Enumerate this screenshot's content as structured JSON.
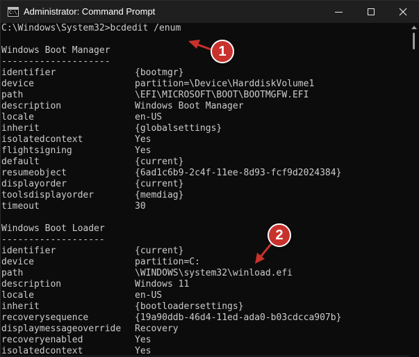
{
  "window": {
    "title": "Administrator: Command Prompt",
    "icon_name": "cmd-icon",
    "icon_text": "C:\\."
  },
  "controls": {
    "minimize_icon": "minimize-icon",
    "maximize_icon": "maximize-icon",
    "close_icon": "close-icon"
  },
  "console": {
    "prompt": "C:\\Windows\\System32>bcdedit /enum",
    "boot_manager": {
      "heading": "Windows Boot Manager",
      "separator": "--------------------",
      "entries": [
        {
          "key": "identifier",
          "value": "{bootmgr}"
        },
        {
          "key": "device",
          "value": "partition=\\Device\\HarddiskVolume1"
        },
        {
          "key": "path",
          "value": "\\EFI\\MICROSOFT\\BOOT\\BOOTMGFW.EFI"
        },
        {
          "key": "description",
          "value": "Windows Boot Manager"
        },
        {
          "key": "locale",
          "value": "en-US"
        },
        {
          "key": "inherit",
          "value": "{globalsettings}"
        },
        {
          "key": "isolatedcontext",
          "value": "Yes"
        },
        {
          "key": "flightsigning",
          "value": "Yes"
        },
        {
          "key": "default",
          "value": "{current}"
        },
        {
          "key": "resumeobject",
          "value": "{6ad1c6b9-2c4f-11ee-8d93-fcf9d2024384}"
        },
        {
          "key": "displayorder",
          "value": "{current}"
        },
        {
          "key": "toolsdisplayorder",
          "value": "{memdiag}"
        },
        {
          "key": "timeout",
          "value": "30"
        }
      ]
    },
    "boot_loader": {
      "heading": "Windows Boot Loader",
      "separator": "-------------------",
      "entries": [
        {
          "key": "identifier",
          "value": "{current}"
        },
        {
          "key": "device",
          "value": "partition=C:"
        },
        {
          "key": "path",
          "value": "\\WINDOWS\\system32\\winload.efi"
        },
        {
          "key": "description",
          "value": "Windows 11"
        },
        {
          "key": "locale",
          "value": "en-US"
        },
        {
          "key": "inherit",
          "value": "{bootloadersettings}"
        },
        {
          "key": "recoverysequence",
          "value": "{19a90ddb-46d4-11ed-ada0-b03cdcca907b}"
        },
        {
          "key": "displaymessageoverride",
          "value": "Recovery"
        },
        {
          "key": "recoveryenabled",
          "value": "Yes"
        },
        {
          "key": "isolatedcontext",
          "value": "Yes"
        }
      ]
    }
  },
  "annotations": [
    {
      "label": "1"
    },
    {
      "label": "2"
    }
  ],
  "colors": {
    "console_bg": "#0c0c0c",
    "console_text": "#cccccc",
    "titlebar_bg": "#1f1f1f",
    "callout_red": "#c8322c"
  }
}
